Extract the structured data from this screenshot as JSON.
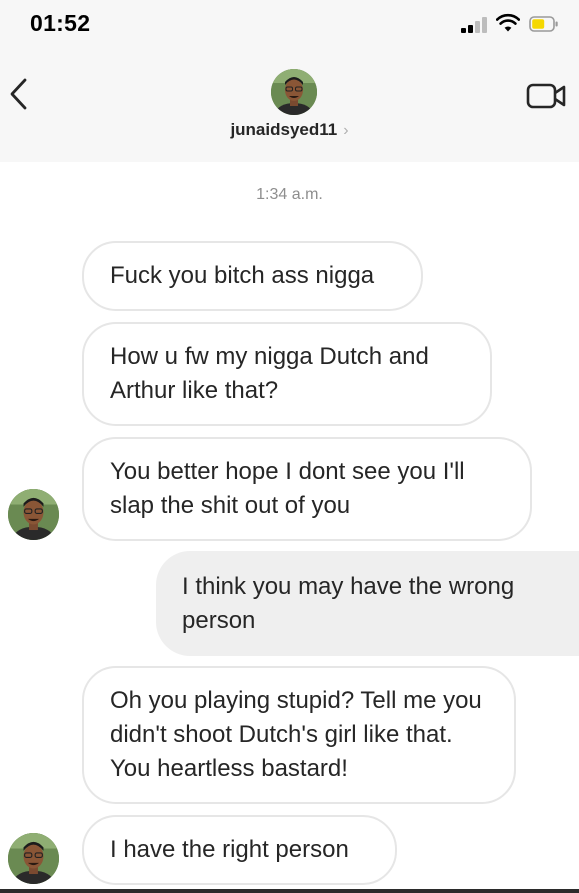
{
  "status_bar": {
    "time": "01:52"
  },
  "header": {
    "username": "junaidsyed11",
    "chevron": "›",
    "back_icon": "chevron-left-icon",
    "video_icon": "video-camera-icon"
  },
  "thread": {
    "timestamp": "1:34 a.m.",
    "messages": [
      {
        "sender": "them",
        "text": "Fuck you bitch ass nigga"
      },
      {
        "sender": "them",
        "text": "How u fw my nigga Dutch and Arthur like that?"
      },
      {
        "sender": "them",
        "text": "You better hope I dont see you I'll slap the shit out of you"
      },
      {
        "sender": "me",
        "text": "I think you may have the wrong person"
      },
      {
        "sender": "them",
        "text": "Oh you playing stupid? Tell me you didn't shoot Dutch's girl like that. You heartless bastard!"
      },
      {
        "sender": "them",
        "text": "I have the right person"
      }
    ]
  },
  "colors": {
    "header_bg": "#f7f7f7",
    "incoming_border": "#e6e6e6",
    "outgoing_bg": "#efefef",
    "battery_fill": "#f5d800",
    "muted_text": "#8e8e8e"
  }
}
